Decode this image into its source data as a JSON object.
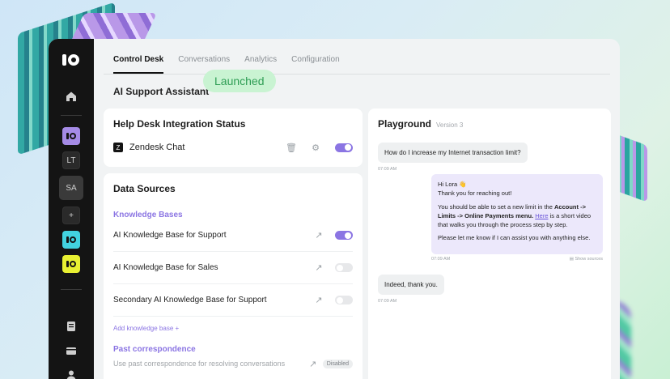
{
  "tabs": [
    "Control Desk",
    "Conversations",
    "Analytics",
    "Configuration"
  ],
  "page": {
    "title": "AI Support Assistant",
    "badge": "Launched"
  },
  "rail": {
    "workspaces": [
      "LT",
      "SA",
      "+"
    ]
  },
  "integration": {
    "title": "Help Desk Integration Status",
    "name": "Zendesk Chat",
    "enabled": true
  },
  "sources": {
    "title": "Data Sources",
    "kb_section": "Knowledge Bases",
    "items": [
      {
        "label": "AI Knowledge Base for Support",
        "enabled": true
      },
      {
        "label": "AI Knowledge Base for Sales",
        "enabled": false
      },
      {
        "label": "Secondary AI Knowledge Base for Support",
        "enabled": false
      }
    ],
    "add_label": "Add knowledge base  +",
    "past_section": "Past correspondence",
    "past_desc": "Use past correspondence for resolving conversations",
    "past_status": "Disabled"
  },
  "playground": {
    "title": "Playground",
    "version": "Version 3",
    "msg1": "How do I increase my Internet transaction limit?",
    "msg1_time": "07:09 AM",
    "bot_greeting": "Hi Lora 👋",
    "bot_thanks": "Thank you for reaching out!",
    "bot_p2_a": "You should be able to set a new limit in the ",
    "bot_p2_bold": "Account -> Limits -> Online Payments menu.",
    "bot_p2_link": "Here",
    "bot_p2_b": " is a short video that walks you through the process step by step.",
    "bot_p3": "Please let me know if I can assist you with anything else.",
    "bot_time": "07:09 AM",
    "show_sources": "Show sources",
    "msg2": "Indeed, thank you.",
    "msg2_time": "07:09 AM"
  }
}
